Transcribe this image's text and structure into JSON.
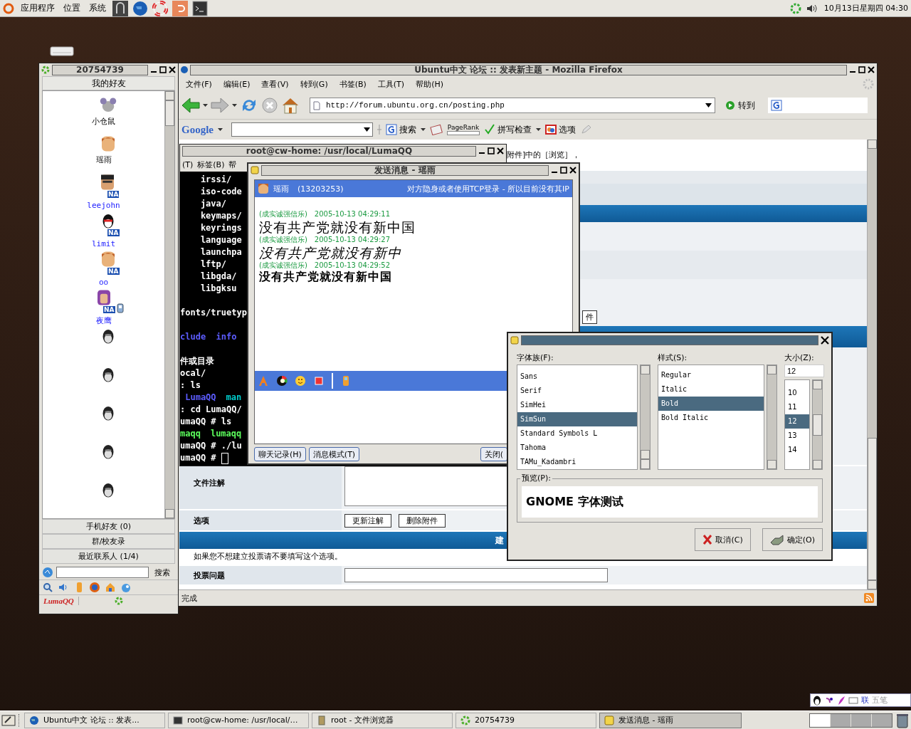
{
  "top_panel": {
    "menus": [
      "应用程序",
      "位置",
      "系统"
    ],
    "clock": "10月13日星期四 04:30"
  },
  "contacts_window": {
    "title": "20754739",
    "group_header": "我的好友",
    "contacts": [
      {
        "kind": "mouse",
        "name": "小仓鼠",
        "away": false
      },
      {
        "kind": "boy",
        "name": "瑶雨",
        "away": false
      },
      {
        "kind": "glasses",
        "name": "leejohn",
        "badge": "NA",
        "away": true
      },
      {
        "kind": "penguin",
        "name": "limit",
        "badge": "NA",
        "away": true
      },
      {
        "kind": "boy",
        "name": "oo",
        "badge": "NA",
        "away": true
      },
      {
        "kind": "girl",
        "name": "夜鹰",
        "badge": "NA",
        "away": true,
        "mobile": true
      },
      {
        "kind": "penguin-gray"
      },
      {
        "kind": "penguin-gray"
      },
      {
        "kind": "penguin-gray"
      },
      {
        "kind": "penguin-gray"
      },
      {
        "kind": "penguin-gray"
      }
    ],
    "groups": [
      "手机好友 (0)",
      "群/校友录",
      "最近联系人 (1/4)"
    ],
    "search_button": "搜索",
    "logo": "LumaQQ"
  },
  "browser": {
    "title": "Ubuntu中文 论坛 :: 发表新主题 - Mozilla Firefox",
    "menus": [
      "文件(F)",
      "编辑(E)",
      "查看(V)",
      "转到(G)",
      "书签(B)",
      "工具(T)",
      "帮助(H)"
    ],
    "url": "http://forum.ubuntu.org.cn/posting.php",
    "go_button": "转到",
    "google_toolbar": {
      "logo": "Google",
      "search_button": "搜索",
      "pagerank": "PageRank",
      "spellcheck": "拼写检查",
      "options": "选项"
    },
    "page": {
      "hint_fragment": "附件]中的［浏览］，",
      "button_fragment": "件",
      "attachment_label": "文件注解",
      "options_label": "选项",
      "option_buttons": [
        "更新注解",
        "删除附件"
      ],
      "section_fragment": "建",
      "poll_note": "如果您不想建立投票请不要填写这个选项。",
      "poll_label": "投票问题"
    },
    "status": "完成"
  },
  "terminal": {
    "title": "root@cw-home: /usr/local/LumaQQ",
    "menus": [
      "(T)",
      "标签(B)",
      "帮"
    ],
    "lines": [
      {
        "kind": "text",
        "segments": [
          {
            "text": "    irssi/",
            "color": "#ffffff"
          }
        ]
      },
      {
        "kind": "text",
        "segments": [
          {
            "text": "    iso-code",
            "color": "#ffffff"
          }
        ]
      },
      {
        "kind": "text",
        "segments": [
          {
            "text": "    java/",
            "color": "#ffffff"
          }
        ]
      },
      {
        "kind": "text",
        "segments": [
          {
            "text": "    keymaps/",
            "color": "#ffffff"
          }
        ]
      },
      {
        "kind": "text",
        "segments": [
          {
            "text": "    keyrings",
            "color": "#ffffff"
          }
        ]
      },
      {
        "kind": "text",
        "segments": [
          {
            "text": "    language",
            "color": "#ffffff"
          }
        ]
      },
      {
        "kind": "text",
        "segments": [
          {
            "text": "    launchpa",
            "color": "#ffffff"
          }
        ]
      },
      {
        "kind": "text",
        "segments": [
          {
            "text": "    lftp/",
            "color": "#ffffff"
          }
        ]
      },
      {
        "kind": "text",
        "segments": [
          {
            "text": "    libgda/",
            "color": "#ffffff"
          }
        ]
      },
      {
        "kind": "text",
        "segments": [
          {
            "text": "    libgksu",
            "color": "#ffffff"
          }
        ]
      },
      {
        "kind": "blank"
      },
      {
        "kind": "text",
        "segments": [
          {
            "text": "fonts/truetyp",
            "color": "#ffffff"
          }
        ]
      },
      {
        "kind": "blank"
      },
      {
        "kind": "text",
        "segments": [
          {
            "text": "clude  info",
            "color": "#5c5cff"
          }
        ]
      },
      {
        "kind": "blank"
      },
      {
        "kind": "text",
        "segments": [
          {
            "text": "件或目录",
            "color": "#ffffff"
          }
        ]
      },
      {
        "kind": "text",
        "segments": [
          {
            "text": "ocal/",
            "color": "#ffffff"
          }
        ]
      },
      {
        "kind": "text",
        "segments": [
          {
            "text": ": ls",
            "color": "#ffffff"
          }
        ]
      },
      {
        "kind": "text",
        "segments": [
          {
            "text": " LumaQQ",
            "color": "#5c5cff"
          },
          {
            "text": "man",
            "color": "#00cdcd"
          }
        ]
      },
      {
        "kind": "text",
        "segments": [
          {
            "text": ": cd LumaQQ/",
            "color": "#ffffff"
          }
        ]
      },
      {
        "kind": "text",
        "segments": [
          {
            "text": "umaQQ # ls",
            "color": "#ffffff"
          }
        ]
      },
      {
        "kind": "text",
        "segments": [
          {
            "text": "maqq",
            "color": "#5cff5c"
          },
          {
            "text": "lumaqq",
            "color": "#5cff5c"
          }
        ]
      },
      {
        "kind": "text",
        "segments": [
          {
            "text": "umaQQ # ./lu",
            "color": "#ffffff"
          }
        ]
      },
      {
        "kind": "prompt",
        "segments": [
          {
            "text": "umaQQ #",
            "color": "#ffffff"
          }
        ]
      }
    ]
  },
  "chat": {
    "title": "发送消息 - 瑶雨",
    "contact": "瑶雨",
    "number": "(13203253)",
    "notice": "对方隐身或者使用TCP登录 - 所以目前没有其IP",
    "messages": [
      {
        "sender": "(成实诚强信乐)",
        "time": "2005-10-13 04:29:11",
        "text": "没有共产党就没有新中国",
        "kind": "normal"
      },
      {
        "sender": "(成实诚强信乐)",
        "time": "2005-10-13 04:29:27",
        "text": "没有共产党就没有新中",
        "kind": "italic"
      },
      {
        "sender": "(成实诚强信乐)",
        "time": "2005-10-13 04:29:52",
        "text": "没有共产党就没有新中国",
        "kind": "bold"
      }
    ],
    "buttons": [
      "聊天记录(H)",
      "消息模式(T)"
    ],
    "close_fragment": "关闭("
  },
  "font_dialog": {
    "family_label": "字体族(F):",
    "style_label": "样式(S):",
    "size_label": "大小(Z):",
    "families": [
      {
        "name": "Sans",
        "selected": false
      },
      {
        "name": "Serif",
        "selected": false
      },
      {
        "name": "SimHei",
        "selected": false
      },
      {
        "name": "SimSun",
        "selected": true
      },
      {
        "name": "Standard Symbols L",
        "selected": false
      },
      {
        "name": "Tahoma",
        "selected": false
      },
      {
        "name": "TAMu_Kadambri",
        "selected": false
      }
    ],
    "styles": [
      {
        "name": "Regular",
        "selected": false
      },
      {
        "name": "Italic",
        "selected": false
      },
      {
        "name": "Bold",
        "selected": true
      },
      {
        "name": "Bold Italic",
        "selected": false
      }
    ],
    "size_value": "12",
    "sizes": [
      {
        "name": "10",
        "selected": false
      },
      {
        "name": "11",
        "selected": false
      },
      {
        "name": "12",
        "selected": true
      },
      {
        "name": "13",
        "selected": false
      },
      {
        "name": "14",
        "selected": false
      }
    ],
    "preview_label": "预览(P):",
    "preview_text": "GNOME 字体测试",
    "cancel": "取消(C)",
    "ok": "确定(O)"
  },
  "input_method": {
    "labels": [
      "联",
      "五笔"
    ]
  },
  "taskbar": [
    {
      "kind": "globe",
      "label": "Ubuntu中文 论坛 :: 发表...",
      "selected": false
    },
    {
      "kind": "terminal",
      "label": "root@cw-home: /usr/local/…",
      "selected": false
    },
    {
      "kind": "cabinet",
      "label": "root - 文件浏览器",
      "selected": false
    },
    {
      "kind": "qq",
      "label": "20754739",
      "selected": false
    },
    {
      "kind": "note",
      "label": "发送消息 - 瑶雨",
      "selected": true
    }
  ]
}
